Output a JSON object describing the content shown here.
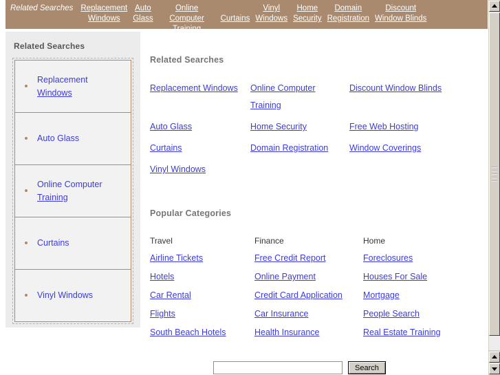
{
  "banner": {
    "brand": "Related Searches",
    "links": [
      {
        "line1": "Replacement",
        "line2": "Windows"
      },
      {
        "line1": "Auto",
        "line2": "Glass"
      },
      {
        "line1": "Online Computer",
        "line2": "Training"
      },
      {
        "line1": "Curtains",
        "line2": ""
      },
      {
        "line1": "Vinyl",
        "line2": "Windows"
      },
      {
        "line1": "Home",
        "line2": "Security"
      },
      {
        "line1": "Domain",
        "line2": "Registration"
      },
      {
        "line1": "Discount",
        "line2": "Window Blinds"
      }
    ]
  },
  "sidebar": {
    "title": "Related Searches",
    "items": [
      {
        "line1": "Replacement",
        "line2": "Windows"
      },
      {
        "line1": "Auto Glass",
        "line2": ""
      },
      {
        "line1": "Online Computer",
        "line2": "Training"
      },
      {
        "line1": "Curtains",
        "line2": ""
      },
      {
        "line1": "Vinyl Windows",
        "line2": ""
      }
    ]
  },
  "related_searches": {
    "heading": "Related Searches",
    "links": [
      "Replacement Windows",
      "Online Computer Training",
      "Discount Window Blinds",
      "Auto Glass",
      "Home Security",
      "Free Web Hosting",
      "Curtains",
      "Domain Registration",
      "Window Coverings",
      "Vinyl Windows",
      "",
      ""
    ]
  },
  "popular_categories": {
    "heading": "Popular Categories",
    "columns": [
      {
        "title": "Travel",
        "links": [
          "Airline Tickets",
          "Hotels",
          "Car Rental",
          "Flights",
          "South Beach Hotels"
        ]
      },
      {
        "title": "Finance",
        "links": [
          "Free Credit Report",
          "Online Payment",
          "Credit Card Application",
          "Car Insurance",
          "Health Insurance"
        ]
      },
      {
        "title": "Home",
        "links": [
          "Foreclosures",
          "Houses For Sale",
          "Mortgage",
          "People Search",
          "Real Estate Training"
        ]
      }
    ]
  },
  "search": {
    "value": "",
    "placeholder": "",
    "button_label": "Search"
  },
  "colors": {
    "banner_background": "#a98a6f",
    "link": "#3b3bdd",
    "sidebar_background": "#ececec",
    "box_border": "#b08968",
    "heading_text": "#757575"
  }
}
